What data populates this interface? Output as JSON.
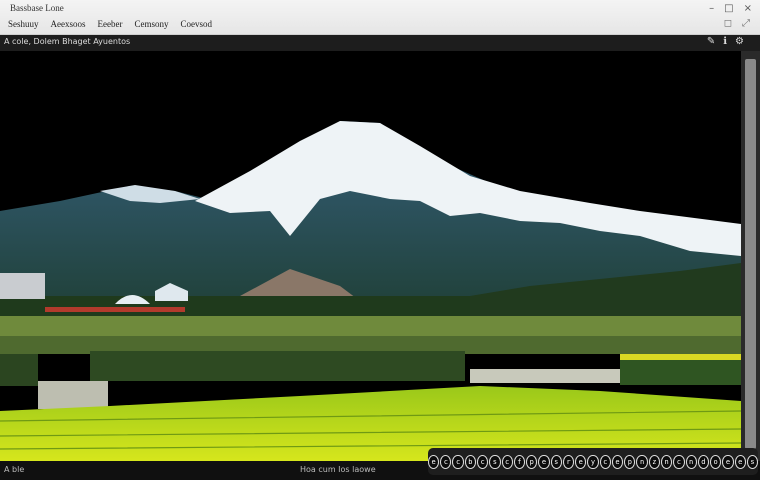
{
  "window": {
    "title": "Bassbase Lone"
  },
  "menu": {
    "items": [
      "Seshuuy",
      "Aeexsoos",
      "Eeeber",
      "Cemsony",
      "Coevsod"
    ]
  },
  "toolbar": {
    "breadcrumb": "A cole, Dolem Bhaget Ayuentos"
  },
  "status": {
    "left": "A ble",
    "mid": "Hoa cum Ios laowe"
  },
  "controls": {
    "glyphs": [
      "e",
      "c",
      "c",
      "b",
      "c",
      "s",
      "c",
      "f",
      "p",
      "e",
      "s",
      "r",
      "e",
      "y",
      "c",
      "e",
      "p",
      "n",
      "z",
      "n",
      "c",
      "n",
      "d",
      "o",
      "e",
      "e",
      "s"
    ]
  },
  "colors": {
    "chrome_light": "#eeeeee",
    "chrome_dark": "#1d1d1d",
    "viewer_bg": "#000000"
  }
}
